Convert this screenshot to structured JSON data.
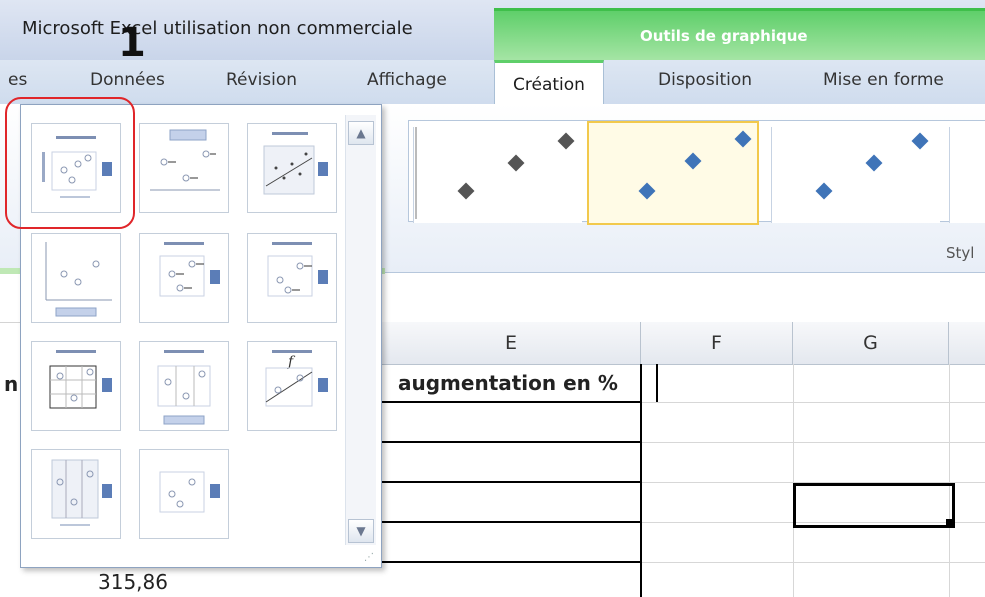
{
  "window": {
    "title": "Microsoft Excel utilisation non commerciale",
    "context_group": "Outils de graphique"
  },
  "tabs": [
    {
      "label": "es",
      "active": false
    },
    {
      "label": "Données",
      "active": false
    },
    {
      "label": "Révision",
      "active": false
    },
    {
      "label": "Affichage",
      "active": false
    },
    {
      "label": "Création",
      "active": true
    },
    {
      "label": "Disposition",
      "active": false
    },
    {
      "label": "Mise en forme",
      "active": false
    }
  ],
  "ribbon": {
    "styles_group_label": "Styl"
  },
  "annotation": {
    "step_number": "1",
    "highlight_color": "#e0262a"
  },
  "layouts": {
    "count": 11,
    "selected_index": 0,
    "items": [
      "layout-1",
      "layout-2",
      "layout-3",
      "layout-4",
      "layout-5",
      "layout-6",
      "layout-7",
      "layout-8",
      "layout-9",
      "layout-10",
      "layout-11"
    ]
  },
  "styles_gallery": {
    "selected_index": 1,
    "marker_color_1": "#555555",
    "marker_color_2": "#3f74b8"
  },
  "sheet": {
    "columns": [
      "E",
      "F",
      "G"
    ],
    "header_cell": "augmentation en %",
    "left_partial_text": "n",
    "bottom_value": "315,86"
  },
  "colors": {
    "context_green": "#5fcf6a",
    "selection_gold": "#f2c94c",
    "accent_blue": "#3f74b8"
  }
}
